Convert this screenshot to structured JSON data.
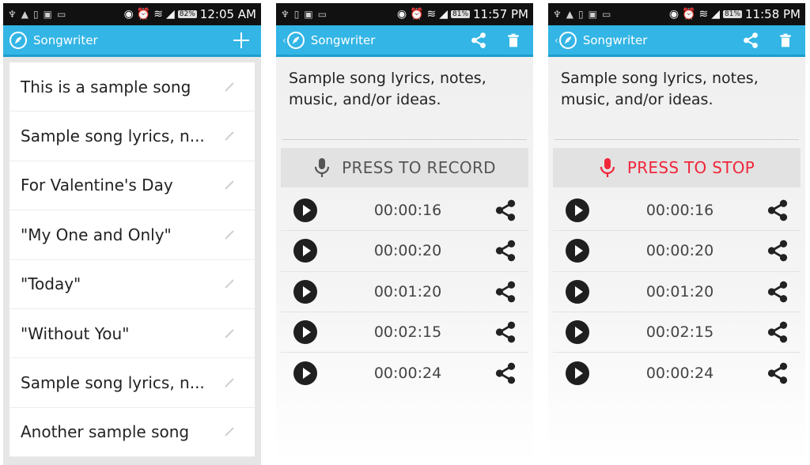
{
  "app": {
    "title": "Songwriter",
    "accent": "#33b5e5",
    "record_stop_color": "#f0263a"
  },
  "screens": [
    {
      "status": {
        "battery": "82%",
        "clock": "12:05 AM"
      },
      "actions": {
        "add": "plus-icon"
      },
      "songs": [
        {
          "title": "This is a sample song"
        },
        {
          "title": "Sample song lyrics, n..."
        },
        {
          "title": "For Valentine's Day"
        },
        {
          "title": "\"My One and Only\""
        },
        {
          "title": "\"Today\""
        },
        {
          "title": "\"Without You\""
        },
        {
          "title": "Sample song lyrics, n..."
        },
        {
          "title": "Another sample song"
        }
      ]
    },
    {
      "status": {
        "battery": "81%",
        "clock": "11:57 PM"
      },
      "lyrics": "Sample song lyrics, notes, music, and/or ideas.",
      "record_button": "PRESS TO RECORD",
      "recordings": [
        {
          "duration": "00:00:16"
        },
        {
          "duration": "00:00:20"
        },
        {
          "duration": "00:01:20"
        },
        {
          "duration": "00:02:15"
        },
        {
          "duration": "00:00:24"
        }
      ]
    },
    {
      "status": {
        "battery": "81%",
        "clock": "11:58 PM"
      },
      "lyrics": "Sample song lyrics, notes, music, and/or ideas.",
      "record_button": "PRESS TO STOP",
      "recordings": [
        {
          "duration": "00:00:16"
        },
        {
          "duration": "00:00:20"
        },
        {
          "duration": "00:01:20"
        },
        {
          "duration": "00:02:15"
        },
        {
          "duration": "00:00:24"
        }
      ]
    }
  ]
}
